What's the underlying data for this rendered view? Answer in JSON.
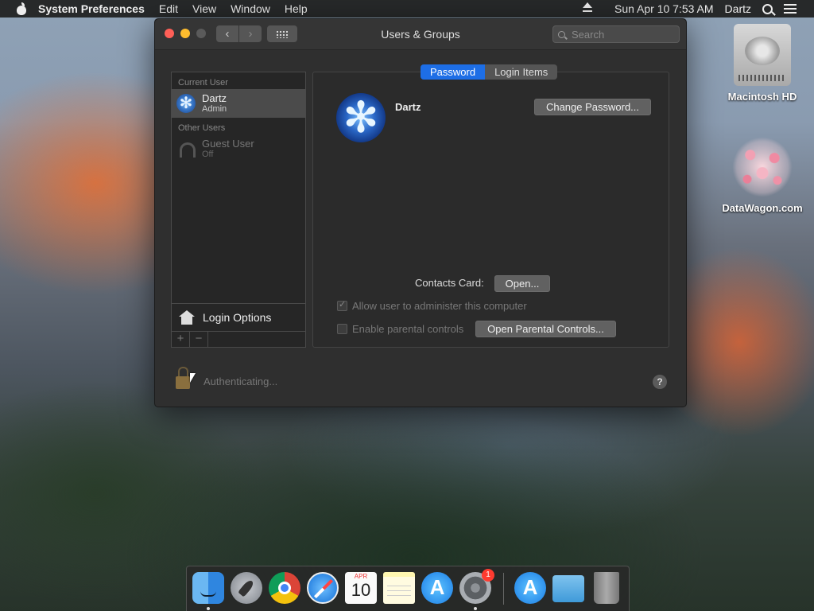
{
  "menubar": {
    "app_name": "System Preferences",
    "items": [
      "Edit",
      "View",
      "Window",
      "Help"
    ],
    "datetime": "Sun Apr 10  7:53 AM",
    "user": "Dartz"
  },
  "window": {
    "title": "Users & Groups",
    "search_placeholder": "Search",
    "back_glyph": "‹",
    "forward_glyph": "›"
  },
  "sidebar": {
    "current_user_header": "Current User",
    "current_user": {
      "name": "Dartz",
      "role": "Admin"
    },
    "other_users_header": "Other Users",
    "other_users": [
      {
        "name": "Guest User",
        "status": "Off"
      }
    ],
    "login_options": "Login Options",
    "add_glyph": "+",
    "remove_glyph": "−"
  },
  "panel": {
    "tabs": [
      "Password",
      "Login Items"
    ],
    "active_tab": "Password",
    "user_name": "Dartz",
    "change_password": "Change Password...",
    "contacts_card_label": "Contacts Card:",
    "open_button": "Open...",
    "allow_admin": {
      "label": "Allow user to administer this computer",
      "checked": true,
      "enabled": false
    },
    "parental": {
      "label": "Enable parental controls",
      "checked": false,
      "enabled": false
    },
    "open_parental": "Open Parental Controls..."
  },
  "footer": {
    "auth_text": "Authenticating...",
    "help_glyph": "?"
  },
  "desktop": {
    "icons": [
      {
        "label": "Macintosh HD",
        "icon": "hard-drive-icon"
      },
      {
        "label": "DataWagon.com",
        "icon": "datawagon-icon"
      }
    ]
  },
  "dock": {
    "calendar_month": "APR",
    "calendar_day": "10",
    "prefs_badge": "1",
    "apps": [
      "Finder",
      "Launchpad",
      "Google Chrome",
      "Safari",
      "Calendar",
      "Notes",
      "App Store",
      "System Preferences",
      "App Store",
      "Downloads",
      "Trash"
    ]
  },
  "colors": {
    "accent_tab": "#1d6ee6",
    "close": "#ff5f57",
    "minimize": "#febc2e",
    "badge": "#ff3b30"
  }
}
